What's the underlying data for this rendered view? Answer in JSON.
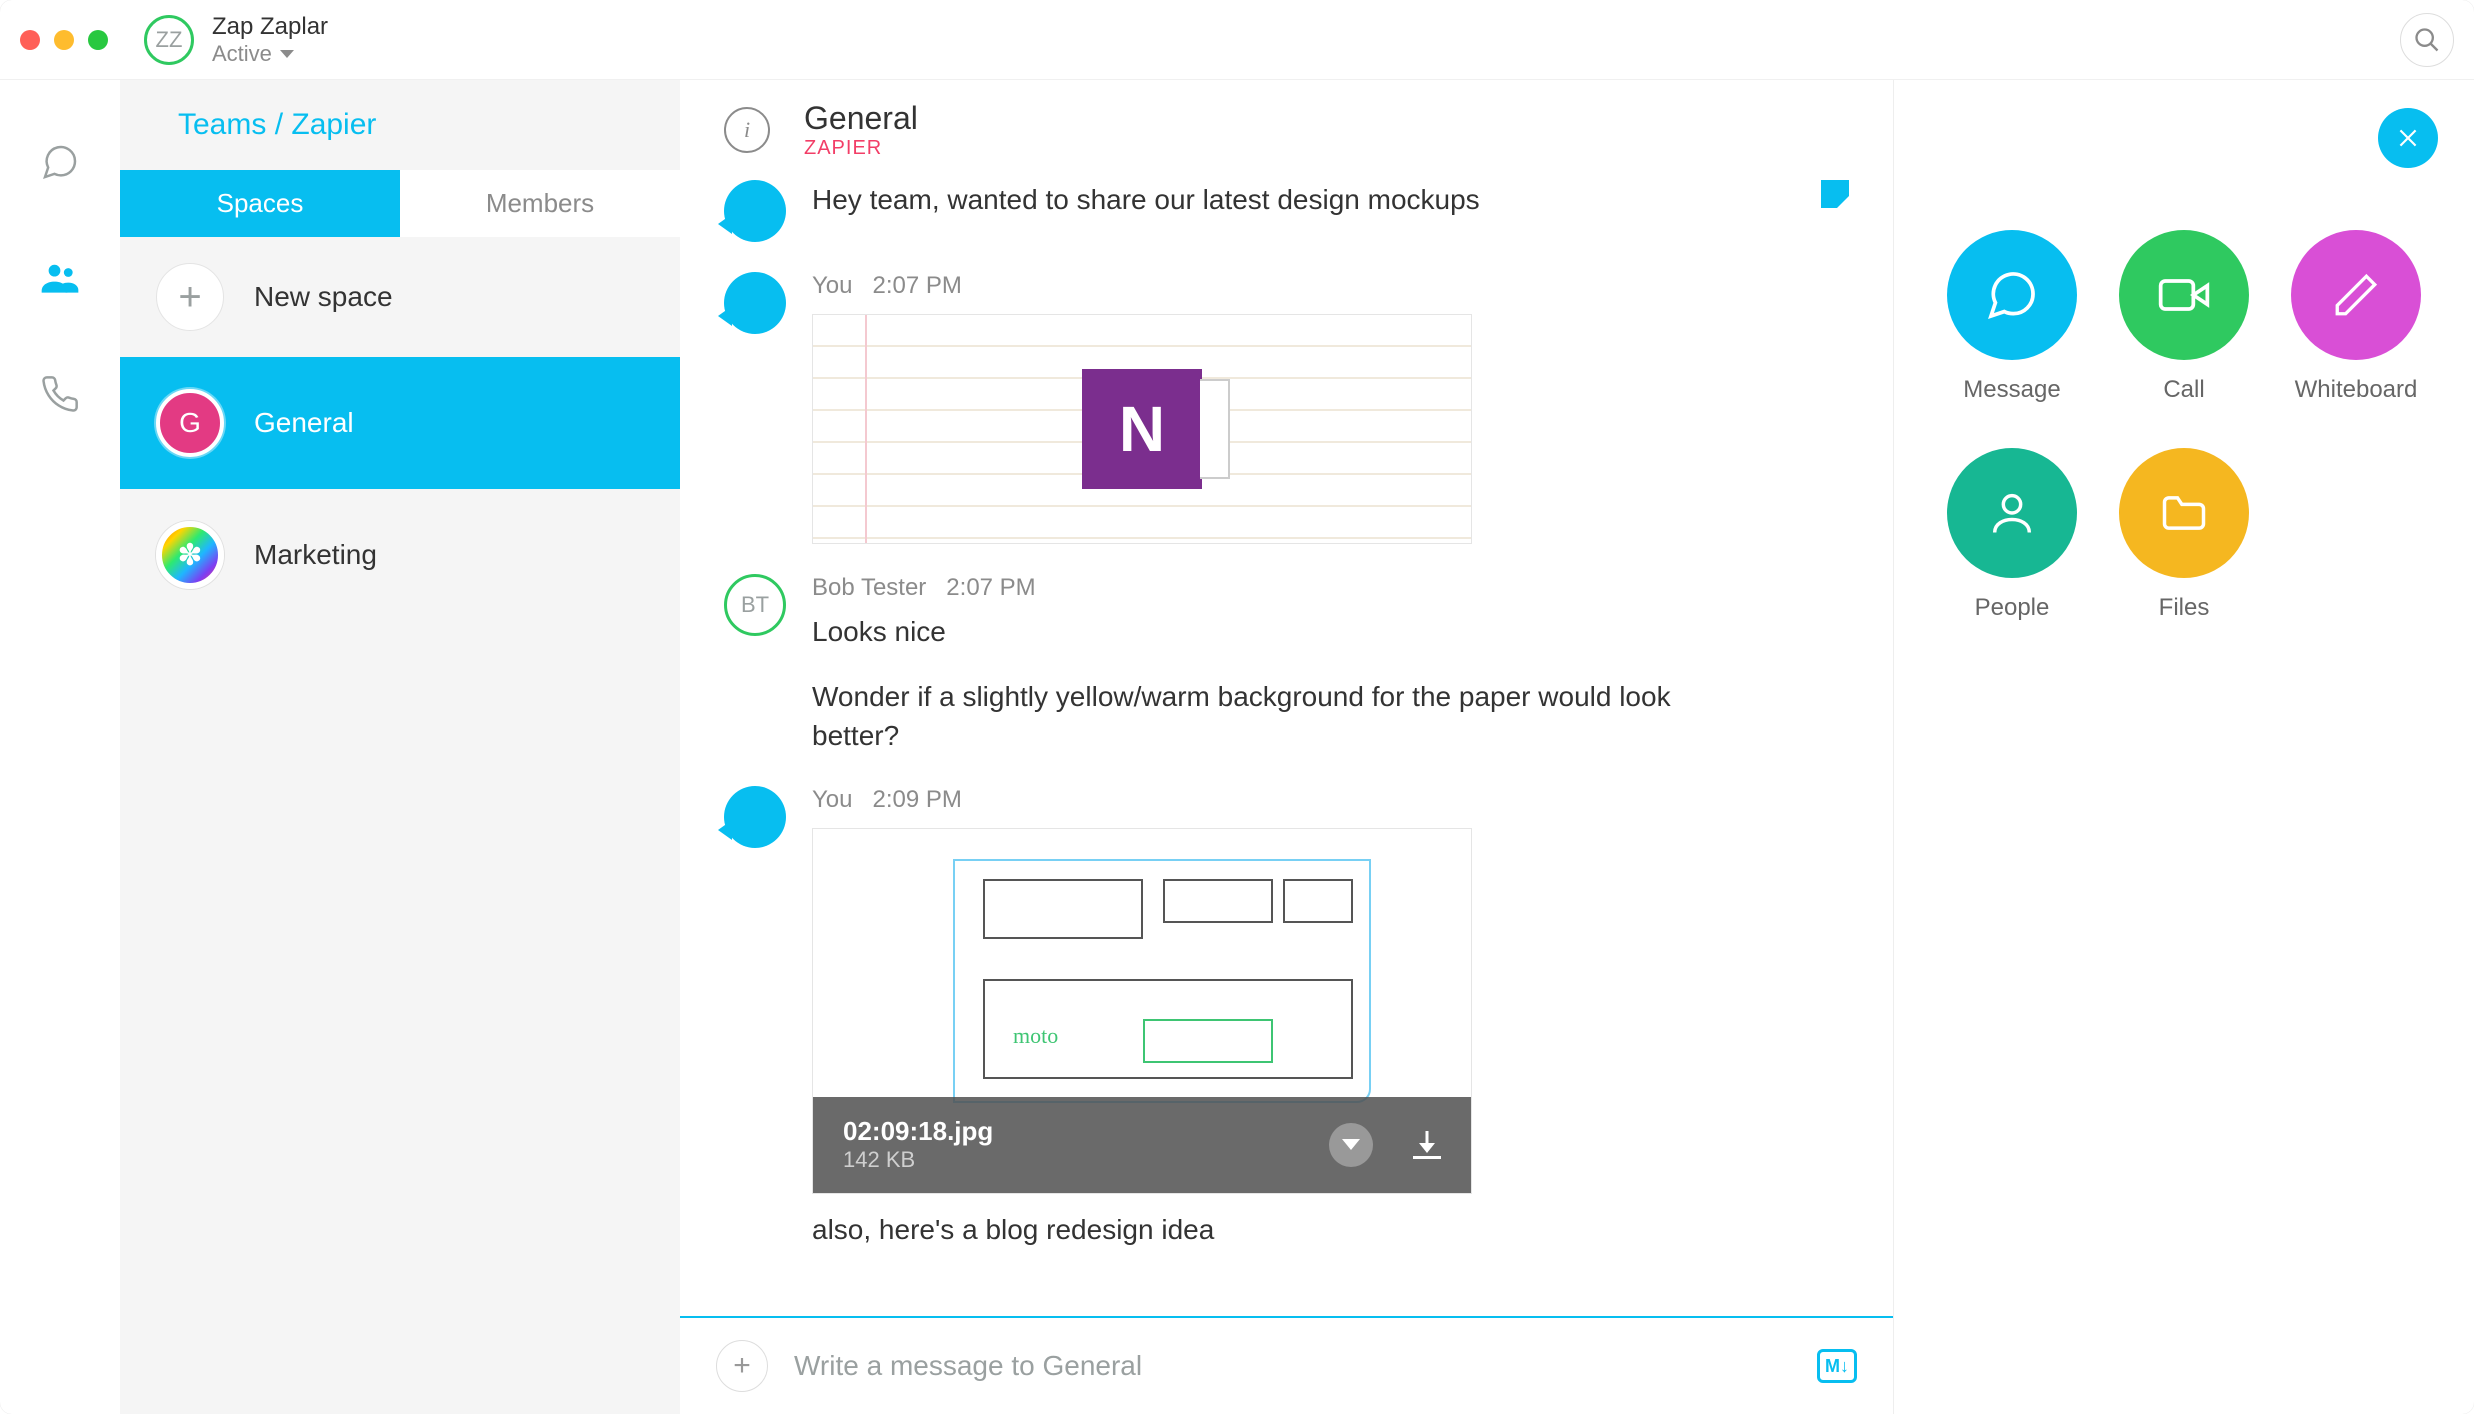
{
  "titlebar": {
    "avatar_initials": "ZZ",
    "user_name": "Zap Zaplar",
    "status": "Active"
  },
  "sidebar": {
    "breadcrumb": "Teams / Zapier",
    "tabs": {
      "spaces": "Spaces",
      "members": "Members"
    },
    "new_space": "New space",
    "spaces": [
      {
        "initial": "G",
        "name": "General"
      },
      {
        "initial": "",
        "name": "Marketing"
      }
    ]
  },
  "header": {
    "space_name": "General",
    "team_name": "ZAPIER"
  },
  "messages": {
    "m0": {
      "text": "Hey team, wanted to share our latest design mockups"
    },
    "m1": {
      "author": "You",
      "time": "2:07 PM"
    },
    "m2": {
      "author": "Bob Tester",
      "time": "2:07 PM",
      "avatar": "BT",
      "line1": "Looks nice",
      "line2": "Wonder if a slightly yellow/warm background for the paper would look better?"
    },
    "m3": {
      "author": "You",
      "time": "2:09 PM",
      "file_name": "02:09:18.jpg",
      "file_size": "142 KB",
      "caption": "also, here's a blog redesign idea",
      "sketch_label": "moto"
    }
  },
  "composer": {
    "placeholder": "Write a message to General"
  },
  "actions": {
    "message": "Message",
    "call": "Call",
    "whiteboard": "Whiteboard",
    "people": "People",
    "files": "Files"
  }
}
